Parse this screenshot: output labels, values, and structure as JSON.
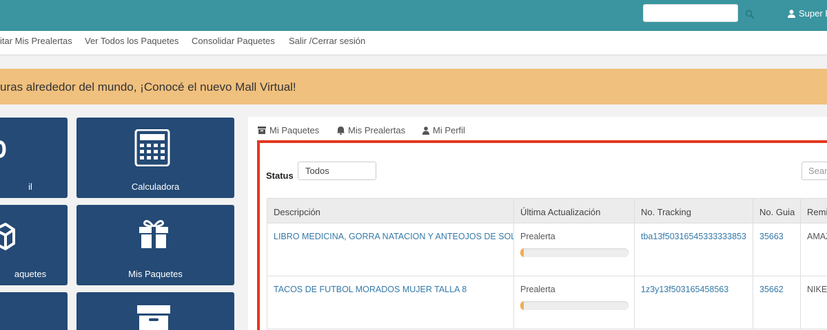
{
  "header": {
    "search_value": "",
    "user_label": "Super E"
  },
  "nav": {
    "items": [
      "itar Mis Prealertas",
      "Ver Todos los Paquetes",
      "Consolidar Paquetes",
      "Salir /Cerrar sesión"
    ]
  },
  "banner": {
    "text": "uras alrededor del mundo, ¡Conocé el nuevo Mall Virtual!"
  },
  "tiles": [
    {
      "label": "il",
      "icon": "person-icon"
    },
    {
      "label": "Calculadora",
      "icon": "calculator-icon"
    },
    {
      "label": "aquetes",
      "icon": "box-icon"
    },
    {
      "label": "Mis Paquetes",
      "icon": "gift-icon"
    },
    {
      "label": "",
      "icon": "blank"
    },
    {
      "label": "",
      "icon": "archive-icon"
    }
  ],
  "tabs": [
    {
      "label": "Mi Paquetes",
      "icon": "archive-icon"
    },
    {
      "label": "Mis Prealertas",
      "icon": "bell-icon"
    },
    {
      "label": "Mi Perfil",
      "icon": "person-icon"
    }
  ],
  "filter": {
    "status_label": "Status",
    "status_value": "Todos",
    "search_placeholder": "Search"
  },
  "table": {
    "headers": [
      "Descripción",
      "Última Actualización",
      "No. Tracking",
      "No. Guia",
      "Remi"
    ],
    "rows": [
      {
        "description": "LIBRO MEDICINA, GORRA NATACION Y ANTEOJOS DE SOL",
        "status": "Prealerta",
        "progress": 0.03,
        "tracking": "tba13f50316545333333853",
        "guia": "35663",
        "remitente": "AMAZ"
      },
      {
        "description": "TACOS DE FUTBOL MORADOS MUJER TALLA 8",
        "status": "Prealerta",
        "progress": 0.03,
        "tracking": "1z3y13f503165458563",
        "guia": "35662",
        "remitente": "NIKE"
      }
    ]
  },
  "colors": {
    "topbar": "#3a95a0",
    "banner": "#f0c07e",
    "tile": "#244a75",
    "highlight": "#e2391f",
    "progress": "#f0ad4e",
    "link": "#3579a8"
  }
}
